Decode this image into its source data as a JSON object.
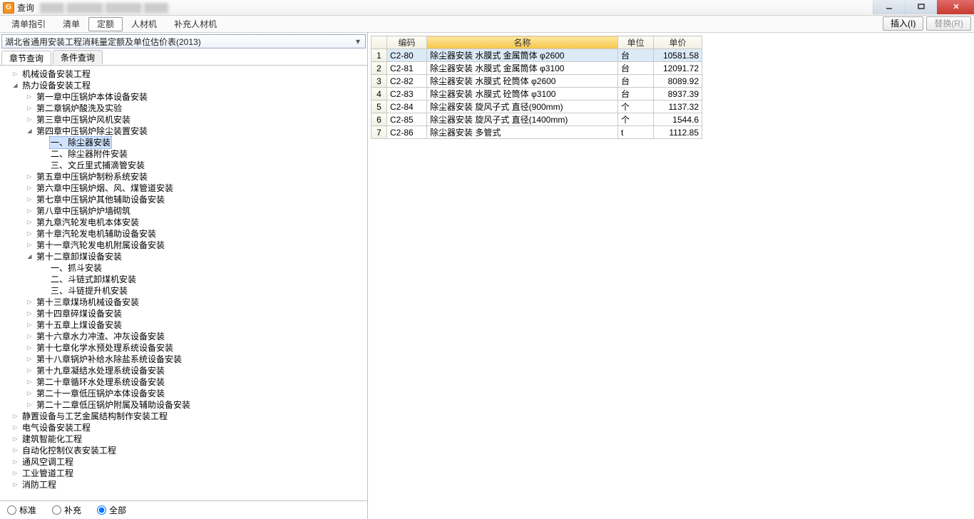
{
  "titlebar": {
    "title": "查询"
  },
  "menubar": {
    "items": [
      {
        "label": "清单指引"
      },
      {
        "label": "清单"
      },
      {
        "label": "定额",
        "active": true
      },
      {
        "label": "人材机"
      },
      {
        "label": "补充人材机"
      }
    ],
    "insert_btn": "插入(I)",
    "replace_btn": "替换(R)"
  },
  "combo": {
    "text": "湖北省通用安装工程消耗量定额及单位估价表(2013)"
  },
  "tabs": [
    {
      "label": "章节查询",
      "active": true
    },
    {
      "label": "条件查询"
    }
  ],
  "tree": [
    {
      "label": "机械设备安装工程",
      "depth": 1,
      "exp": "closed"
    },
    {
      "label": "热力设备安装工程",
      "depth": 1,
      "exp": "open"
    },
    {
      "label": "第一章中压锅炉本体设备安装",
      "depth": 2,
      "exp": "closed"
    },
    {
      "label": "第二章锅炉酸洗及实验",
      "depth": 2,
      "exp": "closed"
    },
    {
      "label": "第三章中压锅炉风机安装",
      "depth": 2,
      "exp": "closed"
    },
    {
      "label": "第四章中压锅炉除尘装置安装",
      "depth": 2,
      "exp": "open"
    },
    {
      "label": "一、除尘器安装",
      "depth": 3,
      "exp": "none",
      "selected": true
    },
    {
      "label": "二、除尘器附件安装",
      "depth": 3,
      "exp": "none"
    },
    {
      "label": "三、文丘里式捕滴管安装",
      "depth": 3,
      "exp": "none"
    },
    {
      "label": "第五章中压锅炉制粉系统安装",
      "depth": 2,
      "exp": "closed"
    },
    {
      "label": "第六章中压锅炉烟、风、煤管道安装",
      "depth": 2,
      "exp": "closed"
    },
    {
      "label": "第七章中压锅炉其他辅助设备安装",
      "depth": 2,
      "exp": "closed"
    },
    {
      "label": "第八章中压锅炉炉墙砌筑",
      "depth": 2,
      "exp": "closed"
    },
    {
      "label": "第九章汽轮发电机本体安装",
      "depth": 2,
      "exp": "closed"
    },
    {
      "label": "第十章汽轮发电机辅助设备安装",
      "depth": 2,
      "exp": "closed"
    },
    {
      "label": "第十一章汽轮发电机附属设备安装",
      "depth": 2,
      "exp": "closed"
    },
    {
      "label": "第十二章卸煤设备安装",
      "depth": 2,
      "exp": "open"
    },
    {
      "label": "一、抓斗安装",
      "depth": 3,
      "exp": "none"
    },
    {
      "label": "二、斗链式卸煤机安装",
      "depth": 3,
      "exp": "none"
    },
    {
      "label": "三、斗链提升机安装",
      "depth": 3,
      "exp": "none"
    },
    {
      "label": "第十三章煤场机械设备安装",
      "depth": 2,
      "exp": "closed"
    },
    {
      "label": "第十四章碎煤设备安装",
      "depth": 2,
      "exp": "closed"
    },
    {
      "label": "第十五章上煤设备安装",
      "depth": 2,
      "exp": "closed"
    },
    {
      "label": "第十六章水力冲渣、冲灰设备安装",
      "depth": 2,
      "exp": "closed"
    },
    {
      "label": "第十七章化学水预处理系统设备安装",
      "depth": 2,
      "exp": "closed"
    },
    {
      "label": "第十八章锅炉补给水除盐系统设备安装",
      "depth": 2,
      "exp": "closed"
    },
    {
      "label": "第十九章凝结水处理系统设备安装",
      "depth": 2,
      "exp": "closed"
    },
    {
      "label": "第二十章循环水处理系统设备安装",
      "depth": 2,
      "exp": "closed"
    },
    {
      "label": "第二十一章低压锅炉本体设备安装",
      "depth": 2,
      "exp": "closed"
    },
    {
      "label": "第二十二章低压锅炉附属及辅助设备安装",
      "depth": 2,
      "exp": "closed"
    },
    {
      "label": "静置设备与工艺金属结构制作安装工程",
      "depth": 1,
      "exp": "closed"
    },
    {
      "label": "电气设备安装工程",
      "depth": 1,
      "exp": "closed"
    },
    {
      "label": "建筑智能化工程",
      "depth": 1,
      "exp": "closed"
    },
    {
      "label": "自动化控制仪表安装工程",
      "depth": 1,
      "exp": "closed"
    },
    {
      "label": "通风空调工程",
      "depth": 1,
      "exp": "closed"
    },
    {
      "label": "工业管道工程",
      "depth": 1,
      "exp": "closed"
    },
    {
      "label": "消防工程",
      "depth": 1,
      "exp": "closed"
    }
  ],
  "radios": {
    "standard": "标准",
    "supplement": "补充",
    "all": "全部"
  },
  "grid": {
    "headers": {
      "code": "编码",
      "name": "名称",
      "unit": "单位",
      "price": "单价"
    },
    "rows": [
      {
        "n": "1",
        "code": "C2-80",
        "name": "除尘器安装 水膜式 金属筒体 φ2600",
        "unit": "台",
        "price": "10581.58",
        "sel": true
      },
      {
        "n": "2",
        "code": "C2-81",
        "name": "除尘器安装 水膜式 金属筒体 φ3100",
        "unit": "台",
        "price": "12091.72"
      },
      {
        "n": "3",
        "code": "C2-82",
        "name": "除尘器安装 水膜式 砼筒体 φ2600",
        "unit": "台",
        "price": "8089.92"
      },
      {
        "n": "4",
        "code": "C2-83",
        "name": "除尘器安装 水膜式 砼筒体 φ3100",
        "unit": "台",
        "price": "8937.39"
      },
      {
        "n": "5",
        "code": "C2-84",
        "name": "除尘器安装 旋风子式 直径(900mm)",
        "unit": "个",
        "price": "1137.32"
      },
      {
        "n": "6",
        "code": "C2-85",
        "name": "除尘器安装 旋风子式 直径(1400mm)",
        "unit": "个",
        "price": "1544.6"
      },
      {
        "n": "7",
        "code": "C2-86",
        "name": "除尘器安装 多管式",
        "unit": "t",
        "price": "1112.85"
      }
    ]
  }
}
